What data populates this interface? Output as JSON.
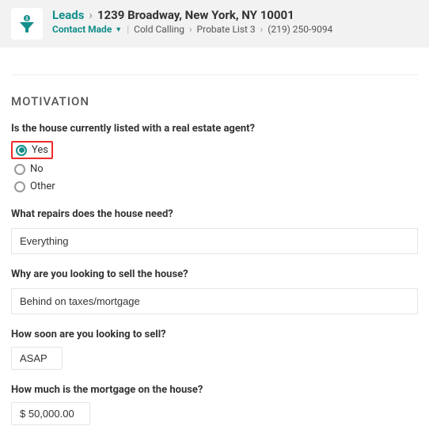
{
  "header": {
    "leads_label": "Leads",
    "address": "1239 Broadway, New York, NY 10001",
    "status_label": "Contact Made",
    "crumb1": "Cold Calling",
    "crumb2": "Probate List 3",
    "crumb3": "(219) 250-9094"
  },
  "section": {
    "title": "MOTIVATION"
  },
  "q1": {
    "label": "Is the house currently listed with a real estate agent?",
    "opt_yes": "Yes",
    "opt_no": "No",
    "opt_other": "Other",
    "selected": "Yes"
  },
  "q2": {
    "label": "What repairs does the house need?",
    "value": "Everything"
  },
  "q3": {
    "label": "Why are you looking to sell the house?",
    "value": "Behind on taxes/mortgage"
  },
  "q4": {
    "label": "How soon are you looking to sell?",
    "value": "ASAP"
  },
  "q5": {
    "label": "How much is the mortgage on the house?",
    "value": "$ 50,000.00"
  }
}
